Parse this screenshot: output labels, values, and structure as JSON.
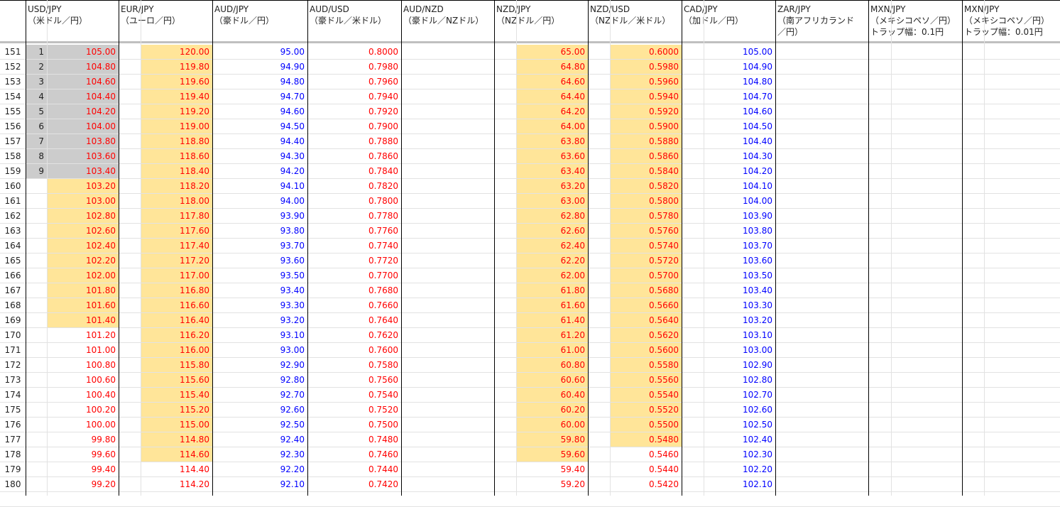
{
  "headers": [
    {
      "key": "usdjpy",
      "line1": "USD/JPY",
      "line2": "（米ドル／円）"
    },
    {
      "key": "eurjpy",
      "line1": "EUR/JPY",
      "line2": "（ユーロ／円）"
    },
    {
      "key": "audjpy",
      "line1": "AUD/JPY",
      "line2": "（豪ドル／円）"
    },
    {
      "key": "audusd",
      "line1": "AUD/USD",
      "line2": "（豪ドル／米ドル）"
    },
    {
      "key": "audnzd",
      "line1": "AUD/NZD",
      "line2": "（豪ドル／NZドル）"
    },
    {
      "key": "nzdjpy",
      "line1": "NZD/JPY",
      "line2": "（NZドル／円）"
    },
    {
      "key": "nzdusd",
      "line1": "NZD/USD",
      "line2": "（NZドル／米ドル）"
    },
    {
      "key": "cadjpy",
      "line1": "CAD/JPY",
      "line2": "（加ドル／円）"
    },
    {
      "key": "zarjpy",
      "line1": "ZAR/JPY",
      "line2": "（南アフリカランド\n／円）"
    },
    {
      "key": "mxnjpy1",
      "line1": "MXN/JPY",
      "line2": "（メキシコペソ／円）\nトラップ幅：0.1円"
    },
    {
      "key": "mxnjpy2",
      "line1": "MXN/JPY",
      "line2": "（メキシコペソ／円）\nトラップ幅：0.01円"
    }
  ],
  "row_numbers": [
    "151",
    "152",
    "153",
    "154",
    "155",
    "156",
    "157",
    "158",
    "159",
    "160",
    "161",
    "162",
    "163",
    "164",
    "165",
    "166",
    "167",
    "168",
    "169",
    "170",
    "171",
    "172",
    "173",
    "174",
    "175",
    "176",
    "177",
    "178",
    "179",
    "180"
  ],
  "counts": [
    "1",
    "2",
    "3",
    "4",
    "5",
    "6",
    "7",
    "8",
    "9"
  ],
  "usdjpy": [
    "105.00",
    "104.80",
    "104.60",
    "104.40",
    "104.20",
    "104.00",
    "103.80",
    "103.60",
    "103.40",
    "103.20",
    "103.00",
    "102.80",
    "102.60",
    "102.40",
    "102.20",
    "102.00",
    "101.80",
    "101.60",
    "101.40",
    "101.20",
    "101.00",
    "100.80",
    "100.60",
    "100.40",
    "100.20",
    "100.00",
    "99.80",
    "99.60",
    "99.40",
    "99.20"
  ],
  "eurjpy": [
    "120.00",
    "119.80",
    "119.60",
    "119.40",
    "119.20",
    "119.00",
    "118.80",
    "118.60",
    "118.40",
    "118.20",
    "118.00",
    "117.80",
    "117.60",
    "117.40",
    "117.20",
    "117.00",
    "116.80",
    "116.60",
    "116.40",
    "116.20",
    "116.00",
    "115.80",
    "115.60",
    "115.40",
    "115.20",
    "115.00",
    "114.80",
    "114.60",
    "114.40",
    "114.20"
  ],
  "audjpy": [
    "95.00",
    "94.90",
    "94.80",
    "94.70",
    "94.60",
    "94.50",
    "94.40",
    "94.30",
    "94.20",
    "94.10",
    "94.00",
    "93.90",
    "93.80",
    "93.70",
    "93.60",
    "93.50",
    "93.40",
    "93.30",
    "93.20",
    "93.10",
    "93.00",
    "92.90",
    "92.80",
    "92.70",
    "92.60",
    "92.50",
    "92.40",
    "92.30",
    "92.20",
    "92.10"
  ],
  "audusd": [
    "0.8000",
    "0.7980",
    "0.7960",
    "0.7940",
    "0.7920",
    "0.7900",
    "0.7880",
    "0.7860",
    "0.7840",
    "0.7820",
    "0.7800",
    "0.7780",
    "0.7760",
    "0.7740",
    "0.7720",
    "0.7700",
    "0.7680",
    "0.7660",
    "0.7640",
    "0.7620",
    "0.7600",
    "0.7580",
    "0.7560",
    "0.7540",
    "0.7520",
    "0.7500",
    "0.7480",
    "0.7460",
    "0.7440",
    "0.7420"
  ],
  "nzdjpy": [
    "65.00",
    "64.80",
    "64.60",
    "64.40",
    "64.20",
    "64.00",
    "63.80",
    "63.60",
    "63.40",
    "63.20",
    "63.00",
    "62.80",
    "62.60",
    "62.40",
    "62.20",
    "62.00",
    "61.80",
    "61.60",
    "61.40",
    "61.20",
    "61.00",
    "60.80",
    "60.60",
    "60.40",
    "60.20",
    "60.00",
    "59.80",
    "59.60",
    "59.40",
    "59.20"
  ],
  "nzdusd": [
    "0.6000",
    "0.5980",
    "0.5960",
    "0.5940",
    "0.5920",
    "0.5900",
    "0.5880",
    "0.5860",
    "0.5840",
    "0.5820",
    "0.5800",
    "0.5780",
    "0.5760",
    "0.5740",
    "0.5720",
    "0.5700",
    "0.5680",
    "0.5660",
    "0.5640",
    "0.5620",
    "0.5600",
    "0.5580",
    "0.5560",
    "0.5540",
    "0.5520",
    "0.5500",
    "0.5480",
    "0.5460",
    "0.5440",
    "0.5420"
  ],
  "cadjpy": [
    "105.00",
    "104.90",
    "104.80",
    "104.70",
    "104.60",
    "104.50",
    "104.40",
    "104.30",
    "104.20",
    "104.10",
    "104.00",
    "103.90",
    "103.80",
    "103.70",
    "103.60",
    "103.50",
    "103.40",
    "103.30",
    "103.20",
    "103.10",
    "103.00",
    "102.90",
    "102.80",
    "102.70",
    "102.60",
    "102.50",
    "102.40",
    "102.30",
    "102.20",
    "102.10"
  ],
  "colors": {
    "red": "#ff0000",
    "blue": "#0000ff",
    "gray_fill": "#cccccc",
    "yellow_fill": "#ffe599"
  }
}
